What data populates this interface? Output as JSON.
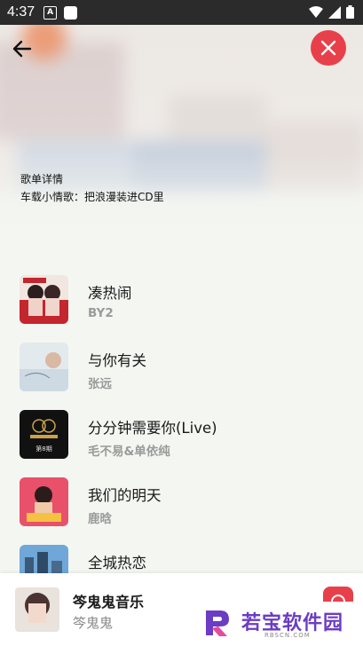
{
  "status_bar": {
    "time": "4:37",
    "a_icon": "A"
  },
  "header": {
    "title": "歌单详情",
    "description": "车载小情歌：把浪漫装进CD里"
  },
  "songs": [
    {
      "title": "凑热闹",
      "artist": "BY2"
    },
    {
      "title": "与你有关",
      "artist": "张远"
    },
    {
      "title": "分分钟需要你(Live)",
      "artist": "毛不易&单依纯",
      "cover_text": "第8期"
    },
    {
      "title": "我们的明天",
      "artist": "鹿晗"
    },
    {
      "title": "全城热恋",
      "artist": ""
    }
  ],
  "player": {
    "title": "笒鬼鬼音乐",
    "artist": "笒鬼鬼"
  },
  "watermark": {
    "text": "若宝软件园",
    "sub": "RBSCN.COM"
  },
  "colors": {
    "accent": "#e8404a",
    "watermark": "#6b3cc4"
  }
}
